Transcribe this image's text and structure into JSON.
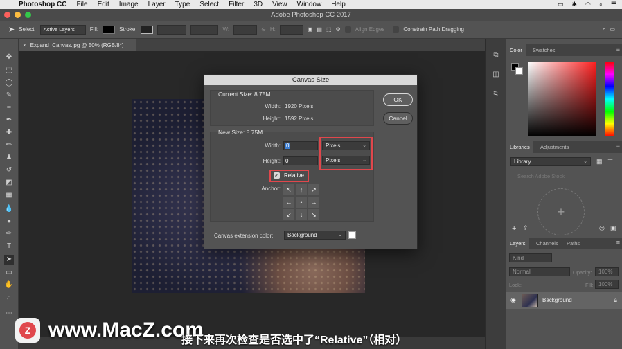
{
  "menubar": {
    "app": "Photoshop CC",
    "items": [
      "File",
      "Edit",
      "Image",
      "Layer",
      "Type",
      "Select",
      "Filter",
      "3D",
      "View",
      "Window",
      "Help"
    ]
  },
  "titlebar": {
    "title": "Adobe Photoshop CC 2017"
  },
  "options": {
    "select_label": "Select:",
    "select_value": "Active Layers",
    "fill_label": "Fill:",
    "stroke_label": "Stroke:",
    "w_label": "W:",
    "h_label": "H:",
    "align_edges": "Align Edges",
    "constrain": "Constrain Path Dragging"
  },
  "document": {
    "tab": "Expand_Canvas.jpg @ 50% (RGB/8*)",
    "close": "×"
  },
  "dialog": {
    "title": "Canvas Size",
    "current_header": "Current Size: 8.75M",
    "current_width_label": "Width:",
    "current_width_value": "1920 Pixels",
    "current_height_label": "Height:",
    "current_height_value": "1592 Pixels",
    "new_header": "New Size: 8.75M",
    "width_label": "Width:",
    "width_value": "0",
    "height_label": "Height:",
    "height_value": "0",
    "width_unit": "Pixels",
    "height_unit": "Pixels",
    "relative_label": "Relative",
    "anchor_label": "Anchor:",
    "extension_label": "Canvas extension color:",
    "extension_value": "Background",
    "ok": "OK",
    "cancel": "Cancel"
  },
  "panels": {
    "color_tabs": [
      "Color",
      "Swatches"
    ],
    "libraries_tabs": [
      "Libraries",
      "Adjustments"
    ],
    "library_select": "Library",
    "library_search": "Search Adobe Stock",
    "layers_tabs": [
      "Layers",
      "Channels",
      "Paths"
    ],
    "kind": "Kind",
    "blend_mode": "Normal",
    "opacity_label": "Opacity:",
    "opacity_value": "100%",
    "lock_label": "Lock:",
    "fill_label": "Fill:",
    "fill_value": "100%",
    "layer_name": "Background"
  },
  "overlay": {
    "watermark": "www.MacZ.com",
    "subtitle": "接下来再次检查是否选中了“Relative”（相对）"
  },
  "colors": {
    "highlight": "#e0474c",
    "selection": "#3d7fd3"
  }
}
